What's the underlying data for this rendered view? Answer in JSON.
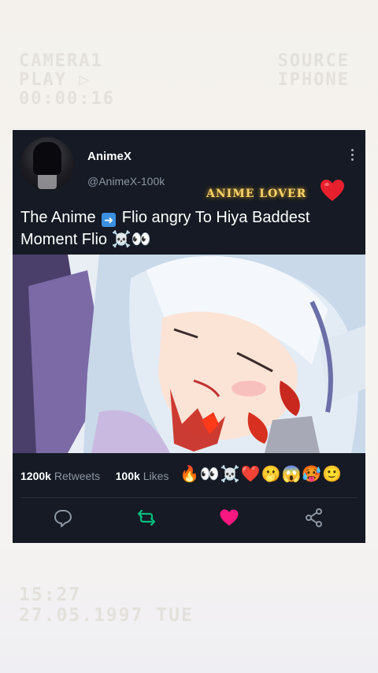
{
  "overlay": {
    "top_left": [
      "CAMERA1",
      "PLAY ▷",
      "00:00:16"
    ],
    "top_right": [
      "SOURCE",
      "IPHONE"
    ],
    "bottom_left": [
      "15:27",
      "27.05.1997 TUE"
    ]
  },
  "post": {
    "author_name": "AnimeX",
    "author_handle": "@AnimeX-100k",
    "badge_text": "ANIME LOVER",
    "text_before_arrow": "The Anime ",
    "text_after_arrow": " Flio angry To Hiya Baddest Moment Flio ☠️👀",
    "retweets_count": "1200k",
    "retweets_label": "Retweets",
    "likes_count": "100k",
    "likes_label": "Likes",
    "reactions": "🔥👀☠️❤️🫢😱🥵🙂"
  },
  "icons": {
    "more": "more-vertical-icon",
    "reply": "reply-icon",
    "retweet": "retweet-icon",
    "like": "heart-icon",
    "share": "share-icon"
  },
  "colors": {
    "card_bg": "#151a24",
    "retweet_green": "#00ba7c",
    "like_pink": "#f91880",
    "muted_text": "#8d96a3"
  }
}
